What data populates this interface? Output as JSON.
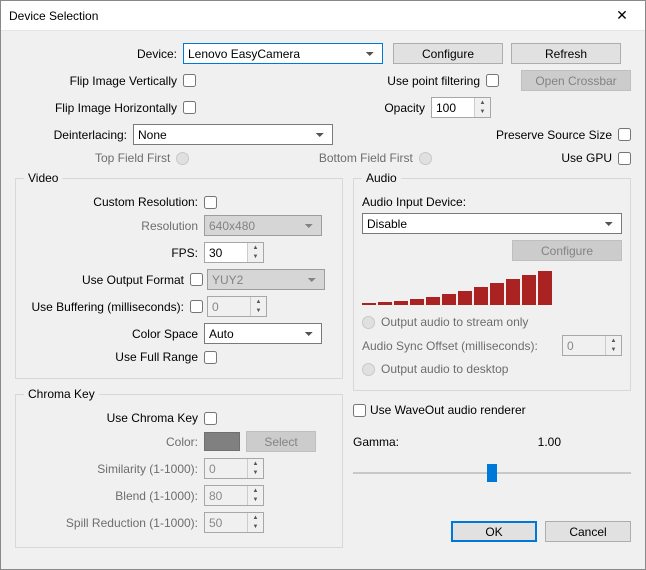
{
  "window": {
    "title": "Device Selection",
    "close_glyph": "✕"
  },
  "header": {
    "device_label": "Device:",
    "device_value": "Lenovo EasyCamera",
    "configure": "Configure",
    "refresh": "Refresh",
    "flip_v": "Flip Image Vertically",
    "use_point_filtering": "Use point filtering",
    "open_crossbar": "Open Crossbar",
    "flip_h": "Flip Image Horizontally",
    "opacity_label": "Opacity",
    "opacity_value": "100",
    "deinterlacing_label": "Deinterlacing:",
    "deinterlacing_value": "None",
    "preserve_source": "Preserve Source Size",
    "top_field": "Top Field First",
    "bottom_field": "Bottom Field First",
    "use_gpu": "Use GPU"
  },
  "video": {
    "legend": "Video",
    "custom_res": "Custom Resolution:",
    "res_label": "Resolution",
    "res_value": "640x480",
    "fps_label": "FPS:",
    "fps_value": "30",
    "use_output_format": "Use Output Format",
    "output_format_value": "YUY2",
    "buffering_label": "Use Buffering (milliseconds):",
    "buffering_value": "0",
    "color_space_label": "Color Space",
    "color_space_value": "Auto",
    "use_full_range": "Use Full Range"
  },
  "chroma": {
    "legend": "Chroma Key",
    "use_chroma": "Use Chroma Key",
    "color_label": "Color:",
    "select": "Select",
    "similarity_label": "Similarity (1-1000):",
    "similarity_value": "0",
    "blend_label": "Blend (1-1000):",
    "blend_value": "80",
    "spill_label": "Spill Reduction (1-1000):",
    "spill_value": "50"
  },
  "audio": {
    "legend": "Audio",
    "input_label": "Audio Input Device:",
    "input_value": "Disable",
    "configure": "Configure",
    "stream_only": "Output audio to stream only",
    "sync_label": "Audio Sync Offset (milliseconds):",
    "sync_value": "0",
    "desktop": "Output audio to desktop",
    "waveout": "Use WaveOut audio renderer",
    "gamma_label": "Gamma:",
    "gamma_value": "1.00"
  },
  "footer": {
    "ok": "OK",
    "cancel": "Cancel"
  },
  "chart_data": {
    "type": "bar",
    "values": [
      2,
      3,
      4,
      6,
      8,
      11,
      14,
      18,
      22,
      26,
      30,
      34
    ],
    "note": "audio level meter bars, relative heights in px"
  }
}
